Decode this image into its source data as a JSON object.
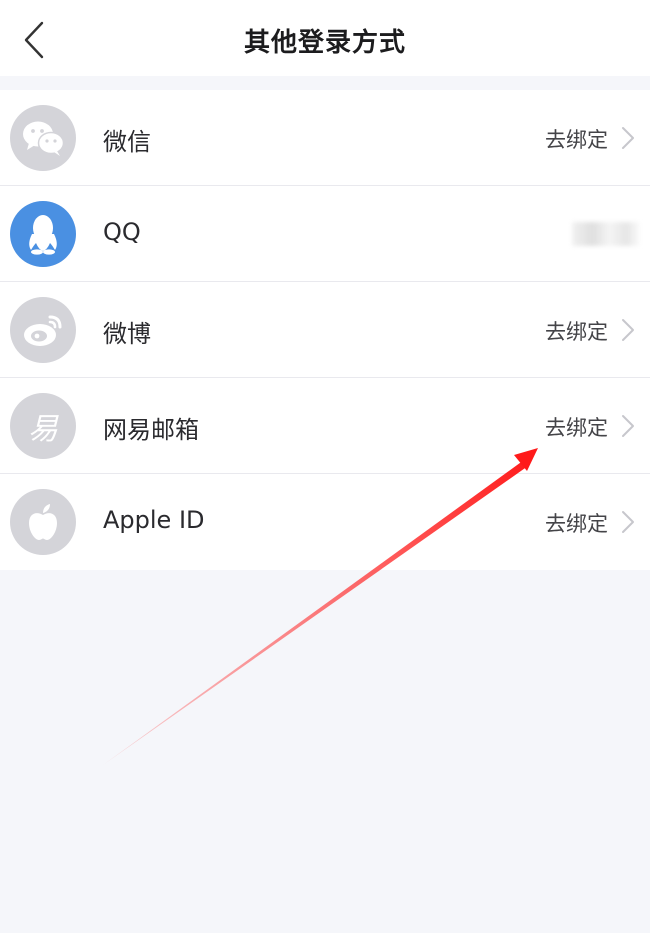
{
  "header": {
    "title": "其他登录方式",
    "back_icon": "chevron-left-icon"
  },
  "accounts": [
    {
      "label": "微信",
      "action": "去绑定",
      "icon": "wechat-icon"
    },
    {
      "label": "QQ",
      "action": "",
      "icon": "qq-icon",
      "status": "bound (value blurred)"
    },
    {
      "label": "微博",
      "action": "去绑定",
      "icon": "weibo-icon"
    },
    {
      "label": "网易邮箱",
      "action": "去绑定",
      "icon": "netease-mail-icon",
      "icon_char": "易"
    },
    {
      "label": "Apple ID",
      "action": "去绑定",
      "icon": "apple-icon"
    }
  ],
  "colors": {
    "background": "#f5f6fa",
    "icon_gray": "#d4d4d9",
    "qq_blue": "#4a90e2",
    "annotation_red": "#ff1a1a"
  }
}
